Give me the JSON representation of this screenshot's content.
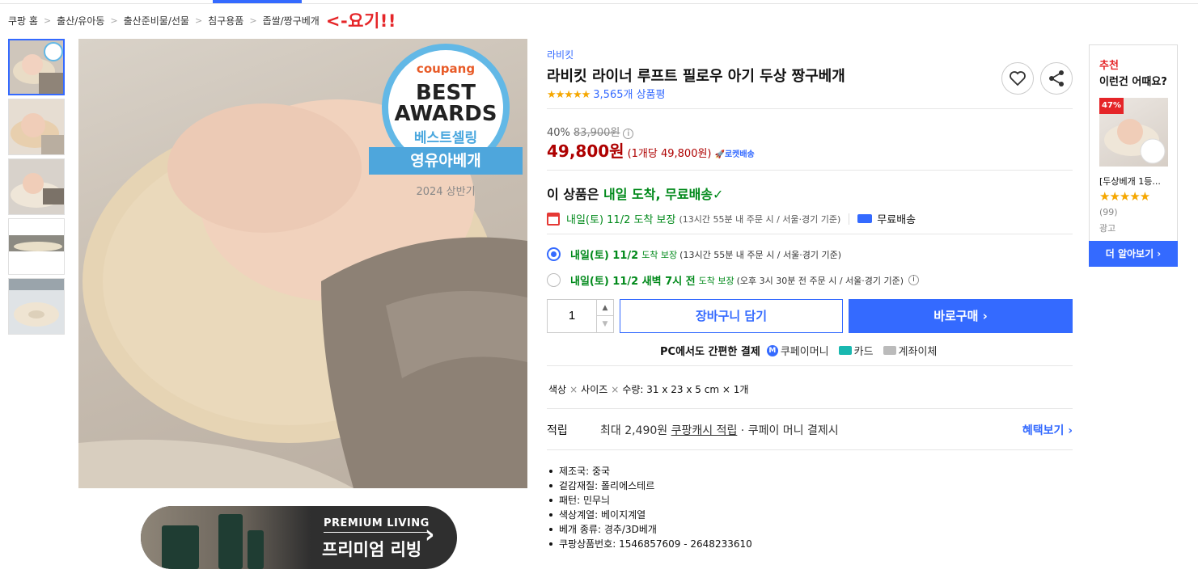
{
  "breadcrumb": {
    "items": [
      "쿠팡 홈",
      "출산/유아동",
      "출산준비물/선물",
      "침구용품",
      "좁쌀/짱구베개"
    ],
    "separator": ">",
    "annotation": "<-요기!!"
  },
  "gallery": {
    "thumbnail_count": 5,
    "selected_index": 0
  },
  "badge": {
    "brand": "coupang",
    "line1": "BEST",
    "line2": "AWARDS",
    "line3": "베스트셀링",
    "ribbon": "영유아베개",
    "period": "2024 상반기"
  },
  "banner": {
    "title": "PREMIUM LIVING",
    "subtitle": "프리미엄 리빙",
    "arrow": "›"
  },
  "product": {
    "brand": "라비킷",
    "title": "라비킷 라이너 루프트 필로우 아기 두상 짱구베개",
    "stars": "★★★★★",
    "review_count": "3,565개 상품평",
    "discount": "40%",
    "original_price": "83,900원",
    "price": "49,800원",
    "unit_price": "(1개당 49,800원)",
    "rocket": "🚀로켓배송"
  },
  "delivery": {
    "headline_prefix": "이 상품은 ",
    "headline_green": "내일 도착, 무료배송",
    "check": "✓",
    "arrive_date": "내일(토) 11/2 도착 보장",
    "arrive_cond": "(13시간 55분  내 주문 시 / 서울·경기 기준)",
    "free_label": "무료배송",
    "options": [
      {
        "bold": "내일(토) 11/2",
        "guarantee": "도착 보장",
        "cond": "(13시간 55분 내 주문 시 / 서울·경기 기준)",
        "selected": true
      },
      {
        "bold": "내일(토) 11/2 새벽 7시 전",
        "guarantee": "도착 보장",
        "cond": "(오후 3시 30분 전 주문 시 / 서울·경기 기준)",
        "selected": false
      }
    ]
  },
  "purchase": {
    "quantity": "1",
    "cart_label": "장바구니 담기",
    "buy_label": "바로구매 ›"
  },
  "payment": {
    "label": "PC에서도 간편한 결제",
    "methods": [
      "쿠페이머니",
      "카드",
      "계좌이체"
    ]
  },
  "option_line": {
    "color": "색상",
    "size": "사이즈",
    "qty_label": "수량:",
    "value": "31 x 23 x 5 cm × 1개"
  },
  "earn": {
    "label": "적립",
    "prefix": "최대 2,490원 ",
    "link": "쿠팡캐시 적립",
    "suffix": " · 쿠페이 머니 결제시",
    "more": "혜택보기 ›"
  },
  "specs": [
    "제조국: 중국",
    "겉감재질: 폴리에스테르",
    "패턴: 민무늬",
    "색상계열: 베이지계열",
    "베개 종류: 경추/3D베개",
    "쿠팡상품번호: 1546857609 - 2648233610"
  ],
  "recommend": {
    "heading": "추천",
    "subheading": "이런건 어때요?",
    "discount_badge": "47%",
    "item_name": "[두상베개 1등...",
    "stars": "★★★★★",
    "reviews": "(99)",
    "ad": "광고",
    "button": "더 알아보기 ›"
  },
  "colors": {
    "accent": "#346aff",
    "price_red": "#ae0000",
    "delivery_green": "#00891a",
    "annotation_red": "#e52528"
  }
}
